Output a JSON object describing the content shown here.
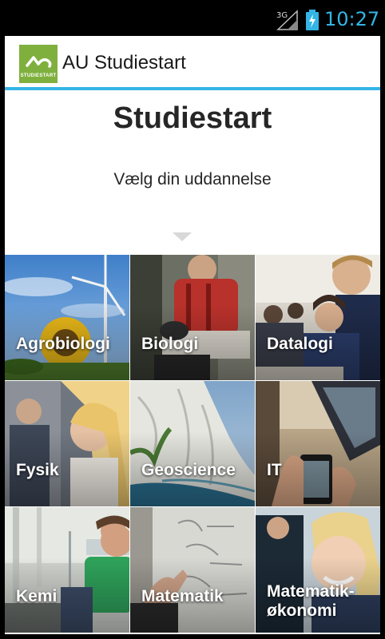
{
  "status_bar": {
    "network": "3G",
    "time": "10:27",
    "accent_color": "#33b5e5"
  },
  "app_bar": {
    "logo_text": "STUDIESTART",
    "title": "AU Studiestart",
    "brand_color": "#7fb03e"
  },
  "header": {
    "title": "Studiestart",
    "subtitle": "Vælg din uddannelse"
  },
  "programmes": [
    {
      "label": "Agrobiologi"
    },
    {
      "label": "Biologi"
    },
    {
      "label": "Datalogi"
    },
    {
      "label": "Fysik"
    },
    {
      "label": "Geoscience"
    },
    {
      "label": "IT"
    },
    {
      "label": "Kemi"
    },
    {
      "label": "Matematik"
    },
    {
      "label": "Matematik-\nøkonomi"
    }
  ]
}
